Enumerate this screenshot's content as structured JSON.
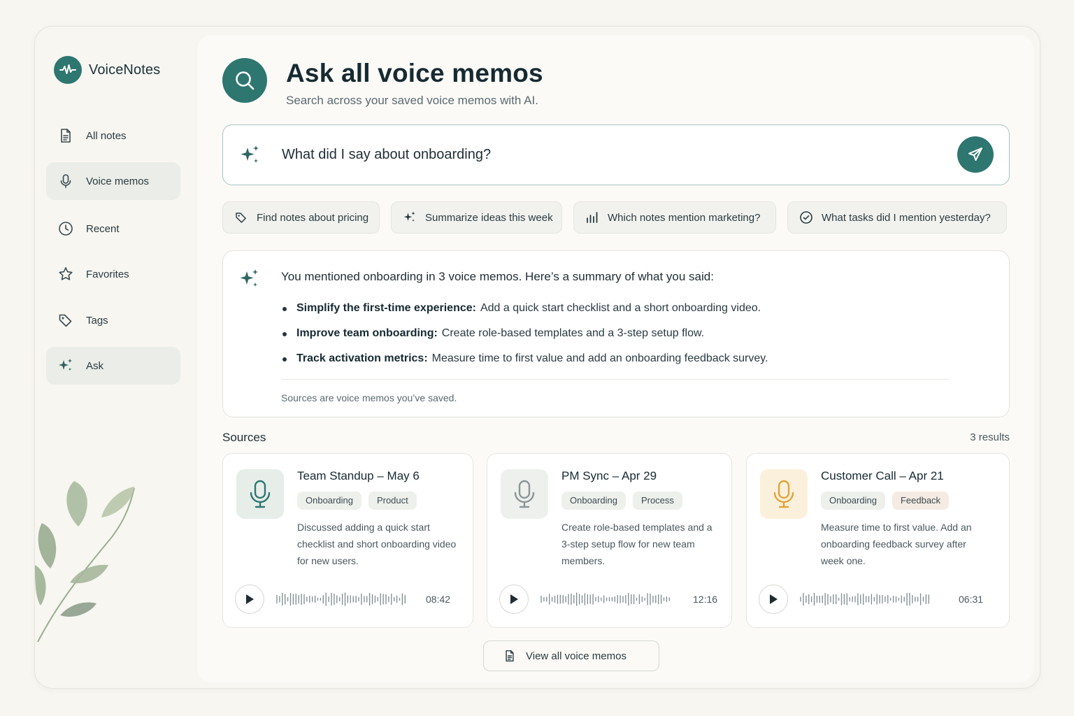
{
  "app": {
    "name": "VoiceNotes"
  },
  "sidebar": {
    "items": [
      {
        "label": "All notes",
        "icon": "document-icon",
        "active": false
      },
      {
        "label": "Voice memos",
        "icon": "microphone-icon",
        "active": true
      },
      {
        "label": "Recent",
        "icon": "clock-icon",
        "active": false
      },
      {
        "label": "Favorites",
        "icon": "star-icon",
        "active": false
      },
      {
        "label": "Tags",
        "icon": "tag-icon",
        "active": false
      },
      {
        "label": "Ask",
        "icon": "sparkle-icon",
        "active": true
      }
    ]
  },
  "header": {
    "title": "Ask all voice memos",
    "subtitle": "Search across your saved voice memos with AI."
  },
  "ask": {
    "query": "What did I say about onboarding?"
  },
  "suggestions": [
    {
      "label": "Find notes about pricing",
      "icon": "tag-icon"
    },
    {
      "label": "Summarize ideas this week",
      "icon": "sparkle-icon"
    },
    {
      "label": "Which notes mention marketing?",
      "icon": "bar-chart-icon"
    },
    {
      "label": "What tasks did I mention yesterday?",
      "icon": "check-circle-icon"
    }
  ],
  "answer": {
    "intro": "You mentioned onboarding in 3 voice memos. Here’s a summary of what you said:",
    "points": [
      {
        "title": "Simplify the first-time experience:",
        "text": "Add a quick start checklist and a short onboarding video."
      },
      {
        "title": "Improve team onboarding:",
        "text": "Create role-based templates and a 3-step setup flow."
      },
      {
        "title": "Track activation metrics:",
        "text": "Measure time to first value and add an onboarding feedback survey."
      }
    ],
    "footnote": "Sources are voice memos you’ve saved."
  },
  "sources": {
    "title": "Sources",
    "count": "3 results",
    "cards": [
      {
        "title": "Team Standup – May 6",
        "tags": [
          "Onboarding",
          "Product"
        ],
        "description": "Discussed adding a quick start checklist and short onboarding video for new users.",
        "duration": "08:42",
        "accent": "#2e7670"
      },
      {
        "title": "PM Sync – Apr 29",
        "tags": [
          "Onboarding",
          "Process"
        ],
        "description": "Create role-based templates and a 3-step setup flow for new team members.",
        "duration": "12:16",
        "accent": "#8a9596"
      },
      {
        "title": "Customer Call – Apr 21",
        "tags": [
          "Onboarding",
          "Feedback"
        ],
        "description": "Measure time to first value. Add an onboarding feedback survey after week one.",
        "duration": "06:31",
        "accent": "#e0a43a"
      }
    ]
  },
  "view_all": {
    "label": "View all voice memos"
  },
  "colors": {
    "brand": "#2e7670",
    "background": "#f8f6f1",
    "accent_warm": "#e0a43a"
  }
}
